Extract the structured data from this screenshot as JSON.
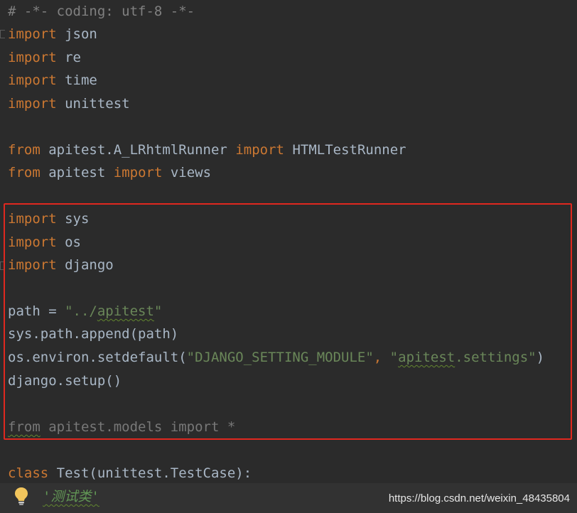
{
  "code": {
    "l1": "# -*- coding: utf-8 -*-",
    "import_kw": "import",
    "from_kw": "from",
    "json": "json",
    "re": "re",
    "time": "time",
    "unittest": "unittest",
    "l6_mod": "apitest.A_LRhtmlRunner",
    "l6_name": "HTMLTestRunner",
    "l7_mod": "apitest",
    "l7_name": "views",
    "sys": "sys",
    "os": "os",
    "django": "django",
    "path_lhs": "path = ",
    "path_str_open": "\"../",
    "path_str_word": "apitest",
    "path_str_close": "\"",
    "append": "sys.path.append(path)",
    "env_pre": "os.environ.setdefault(",
    "env_str1": "\"DJANGO_SETTING_MODULE\"",
    "env_sep": ", ",
    "env_str2_open": "\"",
    "env_str2_word": "apitest",
    "env_str2_rest": ".settings\"",
    "env_close": ")",
    "setup": "django.setup()",
    "models_from": "from",
    "models_mod": " apitest.models ",
    "models_import": "import",
    "models_star": " *",
    "class_kw": "class",
    "class_rest": " Test(unittest.TestCase):"
  },
  "docstring": "'测试类'",
  "watermark": "https://blog.csdn.net/weixin_48435804",
  "colors": {
    "background": "#2b2b2b",
    "keyword": "#cc7832",
    "string": "#6a8759",
    "comment": "#808080",
    "identifier": "#a9b7c6",
    "highlight_border": "#e0281f"
  },
  "icons": {
    "bulb": "lightbulb-icon"
  }
}
